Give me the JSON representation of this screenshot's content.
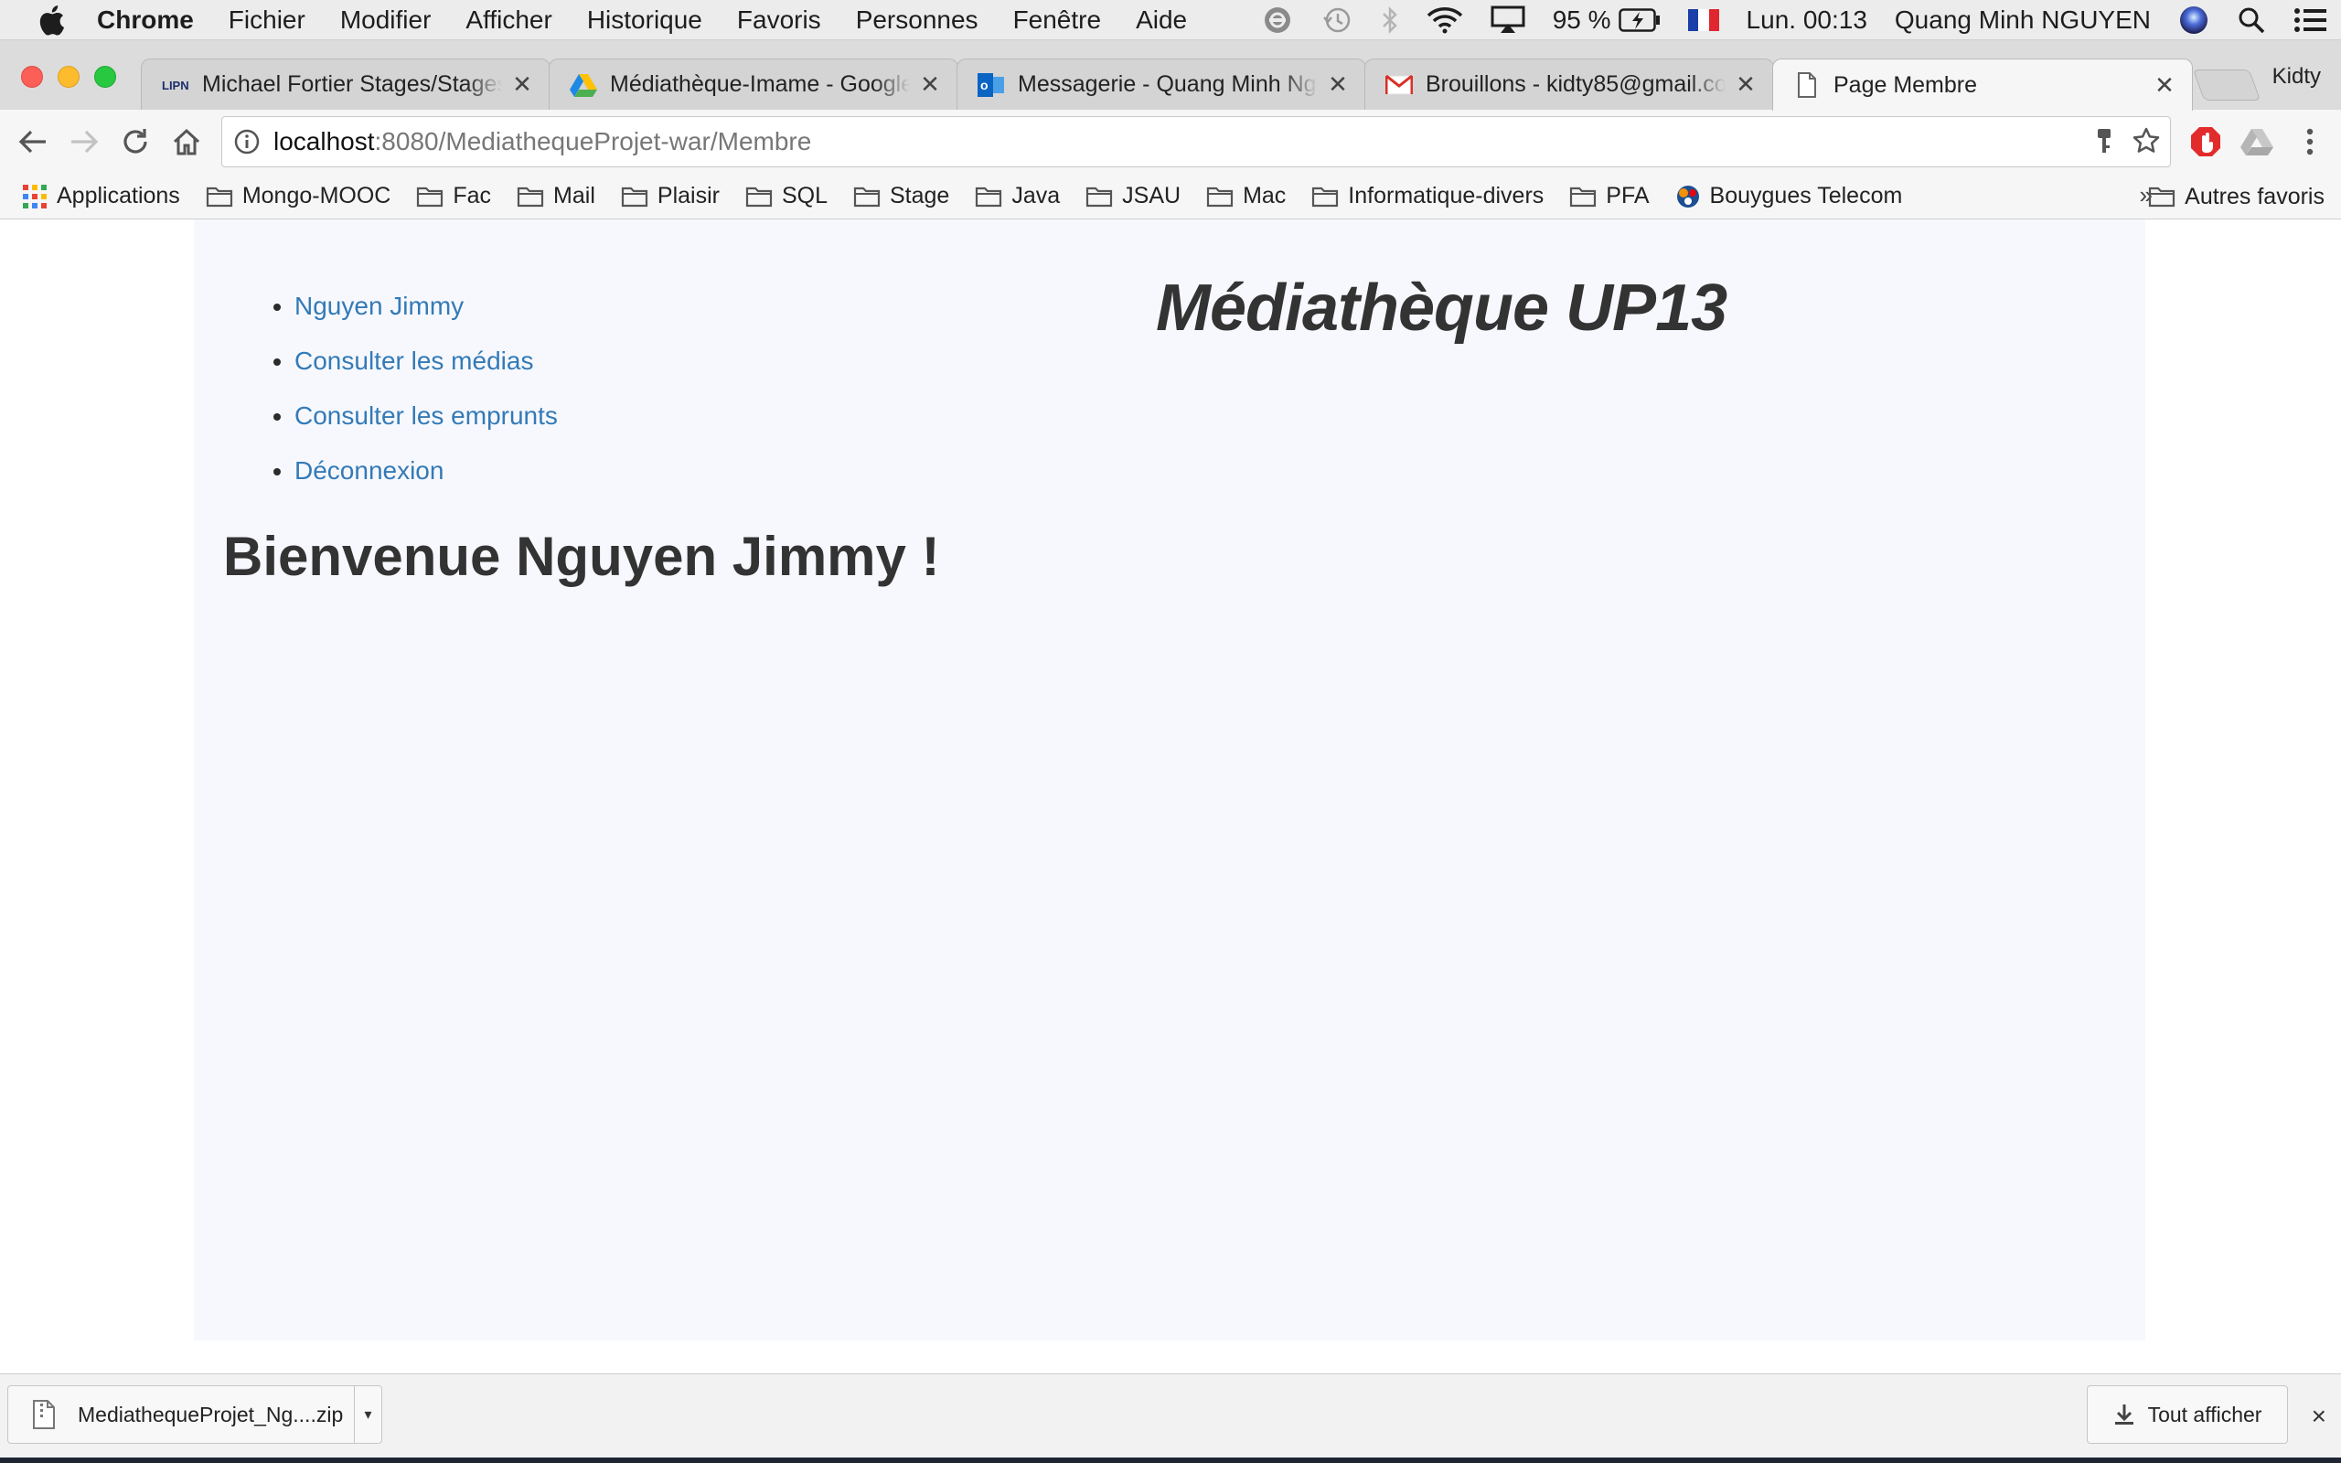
{
  "menubar": {
    "app_name": "Chrome",
    "items": [
      "Fichier",
      "Modifier",
      "Afficher",
      "Historique",
      "Favoris",
      "Personnes",
      "Fenêtre",
      "Aide"
    ],
    "battery": "95 %",
    "clock": "Lun. 00:13",
    "user": "Quang Minh NGUYEN"
  },
  "tabs": [
    {
      "title": "Michael Fortier Stages/Stages",
      "favicon": "lipn-icon",
      "favicon_text": "LIPN"
    },
    {
      "title": "Médiathèque-Imame - Google",
      "favicon": "google-drive-icon"
    },
    {
      "title": "Messagerie - Quang Minh Ngu",
      "favicon": "outlook-icon"
    },
    {
      "title": "Brouillons - kidty85@gmail.co",
      "favicon": "gmail-icon"
    },
    {
      "title": "Page Membre",
      "favicon": "page-icon"
    }
  ],
  "profile": "Kidty",
  "omnibox": {
    "host": "localhost",
    "path": ":8080/MediathequeProjet-war/Membre"
  },
  "bookmarks": {
    "apps_label": "Applications",
    "folders": [
      "Mongo-MOOC",
      "Fac",
      "Mail",
      "Plaisir",
      "SQL",
      "Stage",
      "Java",
      "JSAU",
      "Mac",
      "Informatique-divers",
      "PFA"
    ],
    "bouygues": "Bouygues Telecom",
    "overflow": "»",
    "other": "Autres favoris"
  },
  "page": {
    "nav": [
      "Nguyen Jimmy",
      "Consulter les médias",
      "Consulter les emprunts",
      "Déconnexion"
    ],
    "site_title": "Médiathèque UP13",
    "welcome": "Bienvenue Nguyen Jimmy !"
  },
  "downloads": {
    "file_name": "MediathequeProjet_Ng....zip",
    "show_all": "Tout afficher",
    "close": "×"
  },
  "colors": {
    "link": "#337ab7",
    "page_bg": "#f7f8fd",
    "text": "#333333"
  }
}
